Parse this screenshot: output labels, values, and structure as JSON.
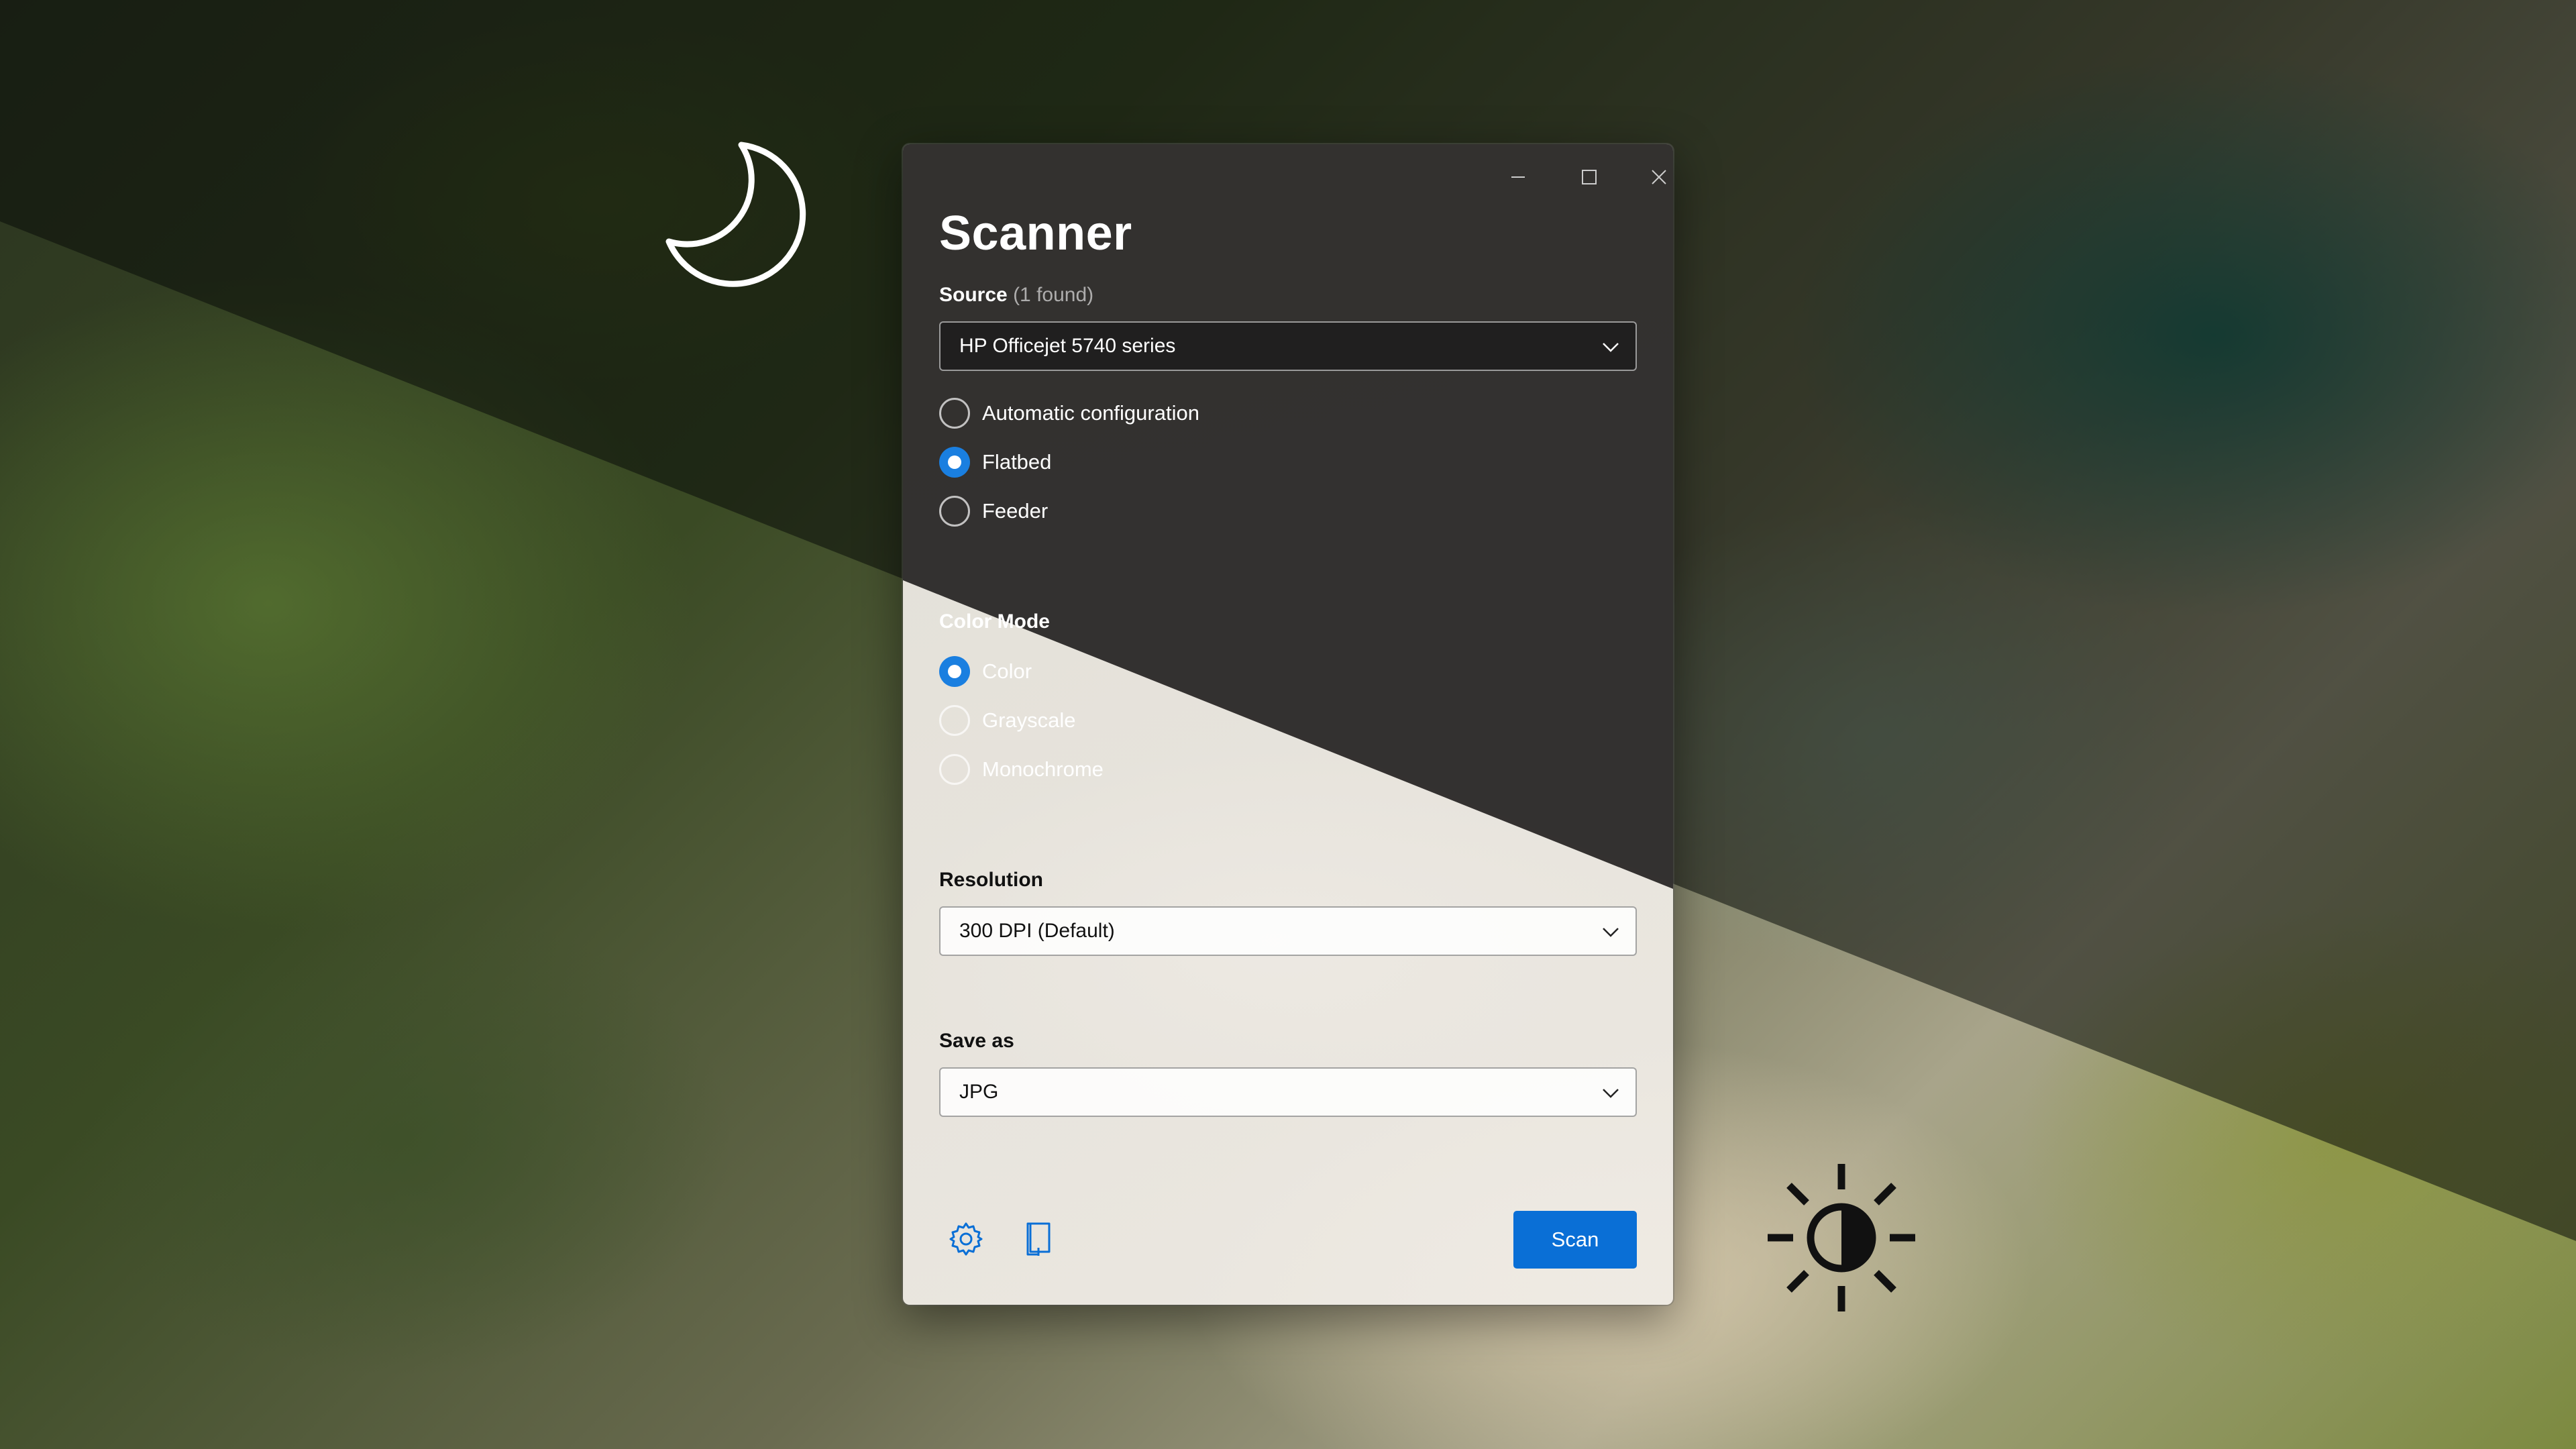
{
  "window": {
    "title": "Scanner",
    "caption": {
      "minimize": "minimize-icon",
      "maximize": "maximize-icon",
      "close": "close-icon"
    }
  },
  "source": {
    "label": "Source",
    "count_text": "(1 found)",
    "selected": "HP Officejet 5740 series",
    "options": [
      {
        "label": "Automatic configuration",
        "checked": false
      },
      {
        "label": "Flatbed",
        "checked": true
      },
      {
        "label": "Feeder",
        "checked": false
      }
    ]
  },
  "color_mode": {
    "label": "Color Mode",
    "options": [
      {
        "label": "Color",
        "checked": true
      },
      {
        "label": "Grayscale",
        "checked": false
      },
      {
        "label": "Monochrome",
        "checked": false
      }
    ]
  },
  "resolution": {
    "label": "Resolution",
    "selected": "300 DPI (Default)"
  },
  "save_as": {
    "label": "Save as",
    "selected": "JPG"
  },
  "footer": {
    "settings_icon": "gear-icon",
    "preview_icon": "document-preview-icon",
    "scan_label": "Scan"
  },
  "theme_glyphs": {
    "dark": "moon-icon",
    "light": "sun-icon"
  },
  "colors": {
    "accent": "#0a6fd6",
    "radio_checked": "#1a7fe0"
  }
}
